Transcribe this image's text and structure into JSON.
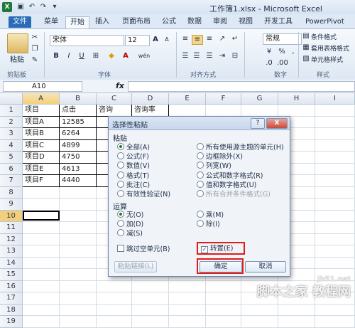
{
  "window": {
    "title": "工作簿1.xlsx - Microsoft Excel",
    "app_icon": "X"
  },
  "quick_access": [
    "save-icon",
    "undo-icon",
    "redo-icon",
    "customize-icon"
  ],
  "ribbon_tabs": [
    "文件",
    "菜单",
    "开始",
    "插入",
    "页面布局",
    "公式",
    "数据",
    "审阅",
    "视图",
    "开发工具",
    "PowerPivot"
  ],
  "ribbon": {
    "clipboard": {
      "paste": "粘贴",
      "group": "剪贴板"
    },
    "font": {
      "name": "宋体",
      "size": "12",
      "bold": "B",
      "italic": "I",
      "underline": "U",
      "grow": "A",
      "shrink": "A",
      "font_color": "A",
      "wen": "wén",
      "group": "字体"
    },
    "alignment": {
      "group": "对齐方式"
    },
    "number": {
      "format": "常规",
      "percent": "%",
      "comma": ",",
      "group": "数字"
    },
    "styles": {
      "conditional": "条件格式",
      "table": "套用表格格式",
      "cell": "单元格样式",
      "group": "样式"
    }
  },
  "formula_bar": {
    "name_box": "A10",
    "fx": "fx",
    "value": ""
  },
  "columns": [
    "A",
    "B",
    "C",
    "D",
    "E",
    "F",
    "G",
    "H",
    "I"
  ],
  "rows": [
    "1",
    "2",
    "3",
    "4",
    "5",
    "6",
    "7",
    "8",
    "9",
    "10",
    "11",
    "12",
    "13",
    "14",
    "15",
    "16",
    "17",
    "18",
    "19"
  ],
  "cells": [
    [
      "项目",
      "点击",
      "咨询",
      "咨询率"
    ],
    [
      "项目A",
      "12585",
      "",
      ""
    ],
    [
      "项目B",
      "6264",
      "",
      ""
    ],
    [
      "项目C",
      "4899",
      "",
      ""
    ],
    [
      "项目D",
      "4750",
      "",
      ""
    ],
    [
      "项目E",
      "4613",
      "",
      ""
    ],
    [
      "项目F",
      "4440",
      "",
      ""
    ]
  ],
  "dialog": {
    "title": "选择性粘贴",
    "help": "?",
    "close": "X",
    "paste_section": "粘贴",
    "paste_options_left": [
      "全部(A)",
      "公式(F)",
      "数值(V)",
      "格式(T)",
      "批注(C)",
      "有效性验证(N)"
    ],
    "paste_options_right": [
      "所有使用源主题的单元(H)",
      "边框除外(X)",
      "列宽(W)",
      "公式和数字格式(R)",
      "值和数字格式(U)",
      "所有合并条件格式(G)"
    ],
    "paste_selected": "全部(A)",
    "operation_section": "运算",
    "operation_left": [
      "无(O)",
      "加(D)",
      "减(S)"
    ],
    "operation_right": [
      "乘(M)",
      "除(I)"
    ],
    "operation_selected": "无(O)",
    "skip_blanks": "跳过空单元(B)",
    "transpose": "转置(E)",
    "transpose_checked": true,
    "paste_link": "粘贴链接(L)",
    "ok": "确定",
    "cancel": "取消"
  },
  "watermark": {
    "url": "jb51.net",
    "text": "脚本之家 教程网"
  },
  "colors": {
    "accent_red": "#e21b1b",
    "file_tab": "#2a6bb8",
    "excel_green": "#1f7a3a"
  }
}
